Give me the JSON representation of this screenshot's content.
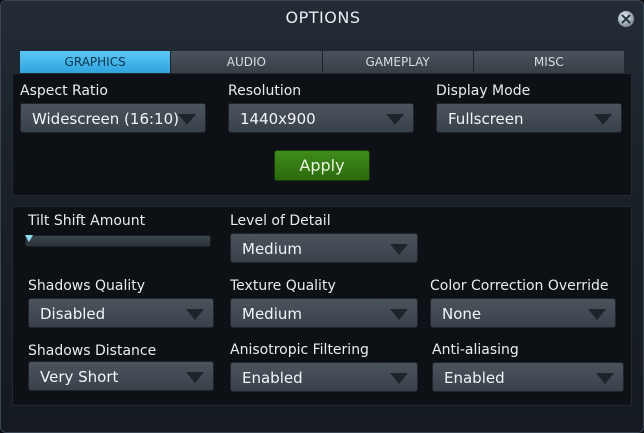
{
  "window": {
    "title": "OPTIONS"
  },
  "tabs": [
    {
      "label": "GRAPHICS",
      "active": true
    },
    {
      "label": "AUDIO",
      "active": false
    },
    {
      "label": "GAMEPLAY",
      "active": false
    },
    {
      "label": "MISC",
      "active": false
    }
  ],
  "display": {
    "aspect_ratio": {
      "label": "Aspect Ratio",
      "value": "Widescreen (16:10)"
    },
    "resolution": {
      "label": "Resolution",
      "value": "1440x900"
    },
    "display_mode": {
      "label": "Display Mode",
      "value": "Fullscreen"
    },
    "apply_label": "Apply"
  },
  "quality": {
    "tilt_shift": {
      "label": "Tilt Shift Amount",
      "level": 0
    },
    "level_of_detail": {
      "label": "Level of Detail",
      "value": "Medium"
    },
    "shadows_quality": {
      "label": "Shadows Quality",
      "value": "Disabled"
    },
    "texture_quality": {
      "label": "Texture Quality",
      "value": "Medium"
    },
    "color_correction": {
      "label": "Color Correction Override",
      "value": "None"
    },
    "shadows_distance": {
      "label": "Shadows Distance",
      "value": "Very Short"
    },
    "anisotropic": {
      "label": "Anisotropic Filtering",
      "value": "Enabled"
    },
    "anti_aliasing": {
      "label": "Anti-aliasing",
      "value": "Enabled"
    }
  },
  "icons": {
    "close": "close-icon",
    "dropdown": "chevron-down-icon"
  },
  "colors": {
    "tab_active": "#2fa3de",
    "apply_button": "#2c6a0e"
  }
}
